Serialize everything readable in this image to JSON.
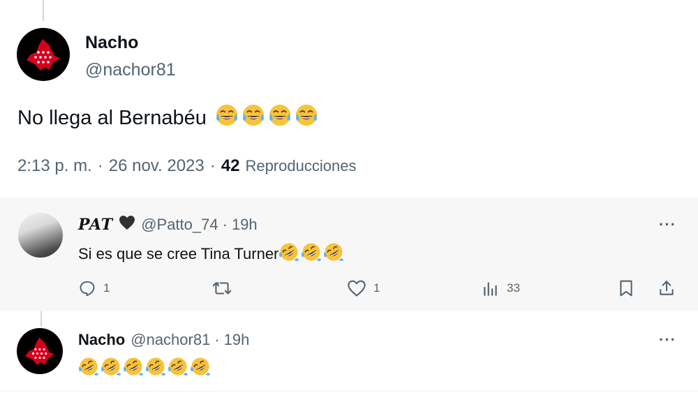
{
  "main_tweet": {
    "author_name": "Nacho",
    "author_handle": "@nachor81",
    "text": "No llega al Bernabéu",
    "emoji_count": 4,
    "emoji_icon": "face-with-tears-of-joy-icon",
    "time": "2:13 p. m.",
    "separator": "·",
    "date": "26 nov. 2023",
    "views_count": "42",
    "views_label": "Reproducciones"
  },
  "replies": [
    {
      "author_name": "PAT",
      "author_handle": "@Patto_74",
      "separator": "·",
      "time": "19h",
      "text": "Si es que se cree Tina Turner",
      "emoji_count": 3,
      "emoji_icon": "rolling-on-floor-laughing-icon",
      "more_label": "···",
      "actions": {
        "reply_count": "1",
        "retweet_count": "",
        "like_count": "1",
        "views_count": "33"
      }
    },
    {
      "author_name": "Nacho",
      "author_handle": "@nachor81",
      "separator": "·",
      "time": "19h",
      "text": "",
      "emoji_count": 6,
      "emoji_icon": "rolling-on-floor-laughing-icon",
      "more_label": "···"
    }
  ],
  "colors": {
    "text_primary": "#0f1419",
    "text_secondary": "#536471",
    "thread_line": "#cfd9de",
    "reply_background": "#f7f7f7",
    "avatar_badge_red": "#d6001c"
  }
}
